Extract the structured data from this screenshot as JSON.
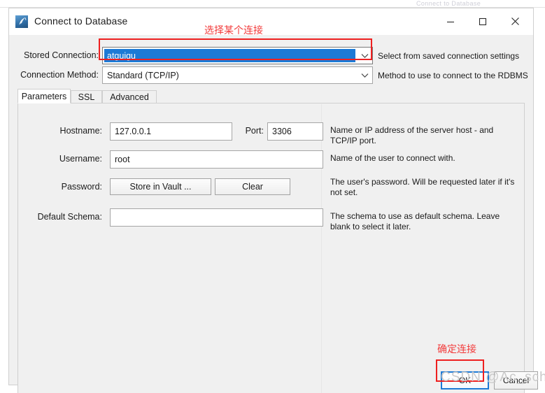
{
  "window": {
    "title": "Connect to Database",
    "icon": "workbench-dolphin-icon",
    "controls": {
      "minimize": "minimize-icon",
      "maximize": "maximize-icon",
      "close": "close-icon"
    },
    "background_ghost_text": "Connect to Database"
  },
  "form": {
    "stored_connection": {
      "label": "Stored Connection:",
      "value": "atguigu",
      "hint": "Select from saved connection settings"
    },
    "connection_method": {
      "label": "Connection Method:",
      "value": "Standard (TCP/IP)",
      "hint": "Method to use to connect to the RDBMS"
    }
  },
  "tabs": [
    {
      "label": "Parameters",
      "active": true
    },
    {
      "label": "SSL",
      "active": false
    },
    {
      "label": "Advanced",
      "active": false
    }
  ],
  "parameters": {
    "hostname": {
      "label": "Hostname:",
      "value": "127.0.0.1",
      "hint": "Name or IP address of the server host - and\nTCP/IP port."
    },
    "port": {
      "label": "Port:",
      "value": "3306"
    },
    "username": {
      "label": "Username:",
      "value": "root",
      "hint": "Name of the user to connect with."
    },
    "password": {
      "label": "Password:",
      "store_button": "Store in Vault ...",
      "clear_button": "Clear",
      "hint": "The user's password. Will be requested later if it's\nnot set."
    },
    "default_schema": {
      "label": "Default Schema:",
      "value": "",
      "hint": "The schema to use as default schema. Leave\nblank to select it later."
    }
  },
  "footer": {
    "ok": "OK",
    "cancel": "Cancel"
  },
  "annotations": {
    "select_connection": "选择某个连接",
    "confirm_connection": "确定连接"
  },
  "watermark": "CSDN @Ac_sch",
  "colors": {
    "accent_blue": "#1c7ad6",
    "annotation_red": "#ee2020",
    "dialog_bg": "#f0f0f0",
    "titlebar_bg": "#ffffff"
  }
}
